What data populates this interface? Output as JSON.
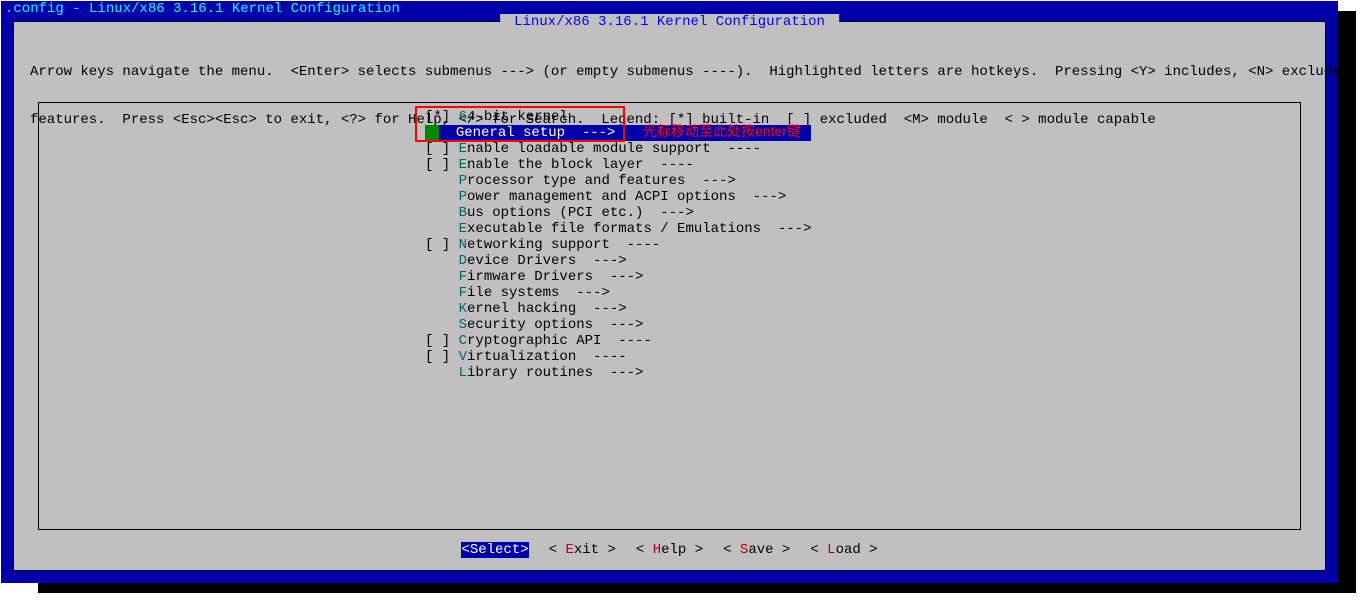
{
  "window": {
    "title": ".config - Linux/x86 3.16.1 Kernel Configuration"
  },
  "dialog": {
    "title": " Linux/x86 3.16.1 Kernel Configuration ",
    "help_line1": "Arrow keys navigate the menu.  <Enter> selects submenus ---> (or empty submenus ----).  Highlighted letters are hotkeys.  Pressing <Y> includes, <N> excludes, <M> modularizes",
    "help_line2": "features.  Press <Esc><Esc> to exit, <?> for Help, </> for Search.  Legend: [*] built-in  [ ] excluded  <M> module  < > module capable"
  },
  "menu_items": [
    {
      "prefix": "[*] ",
      "hotkey": "6",
      "label": "4-bit kernel"
    },
    {
      "prefix": "    ",
      "hotkey": "G",
      "label": "eneral setup  --->",
      "selected": true
    },
    {
      "prefix": "[ ] ",
      "hotkey": "E",
      "label": "nable loadable module support  ----"
    },
    {
      "prefix": "[ ] ",
      "hotkey": "E",
      "label": "nable the block layer  ----"
    },
    {
      "prefix": "    ",
      "hotkey": "P",
      "label": "rocessor type and features  --->"
    },
    {
      "prefix": "    ",
      "hotkey": "P",
      "label": "ower management and ACPI options  --->"
    },
    {
      "prefix": "    ",
      "hotkey": "B",
      "label": "us options (PCI etc.)  --->"
    },
    {
      "prefix": "    ",
      "hotkey": "E",
      "label": "xecutable file formats / Emulations  --->"
    },
    {
      "prefix": "[ ] ",
      "hotkey": "N",
      "label": "etworking support  ----"
    },
    {
      "prefix": "    ",
      "hotkey": "D",
      "label": "evice Drivers  --->"
    },
    {
      "prefix": "    ",
      "hotkey": "F",
      "label": "irmware Drivers  --->"
    },
    {
      "prefix": "    ",
      "hotkey": "F",
      "label": "ile systems  --->"
    },
    {
      "prefix": "    ",
      "hotkey": "K",
      "label": "ernel hacking  --->"
    },
    {
      "prefix": "    ",
      "hotkey": "S",
      "label": "ecurity options  --->"
    },
    {
      "prefix": "[ ] ",
      "hotkey": "C",
      "label": "ryptographic API  ----"
    },
    {
      "prefix": "[ ] ",
      "hotkey": "V",
      "label": "irtualization  ----"
    },
    {
      "prefix": "    ",
      "hotkey": "L",
      "label": "ibrary routines  --->"
    }
  ],
  "annotation": "光标移动至此处按enter键",
  "buttons": [
    {
      "html": "<Select>",
      "hotkey": "S",
      "pre": "<",
      "mid": "elect>",
      "selected": true
    },
    {
      "pre": "< ",
      "hotkey": "E",
      "mid": "xit >"
    },
    {
      "pre": "< ",
      "hotkey": "H",
      "mid": "elp >"
    },
    {
      "pre": "< ",
      "hotkey": "S",
      "mid": "ave >"
    },
    {
      "pre": "< ",
      "hotkey": "L",
      "mid": "oad >"
    }
  ]
}
